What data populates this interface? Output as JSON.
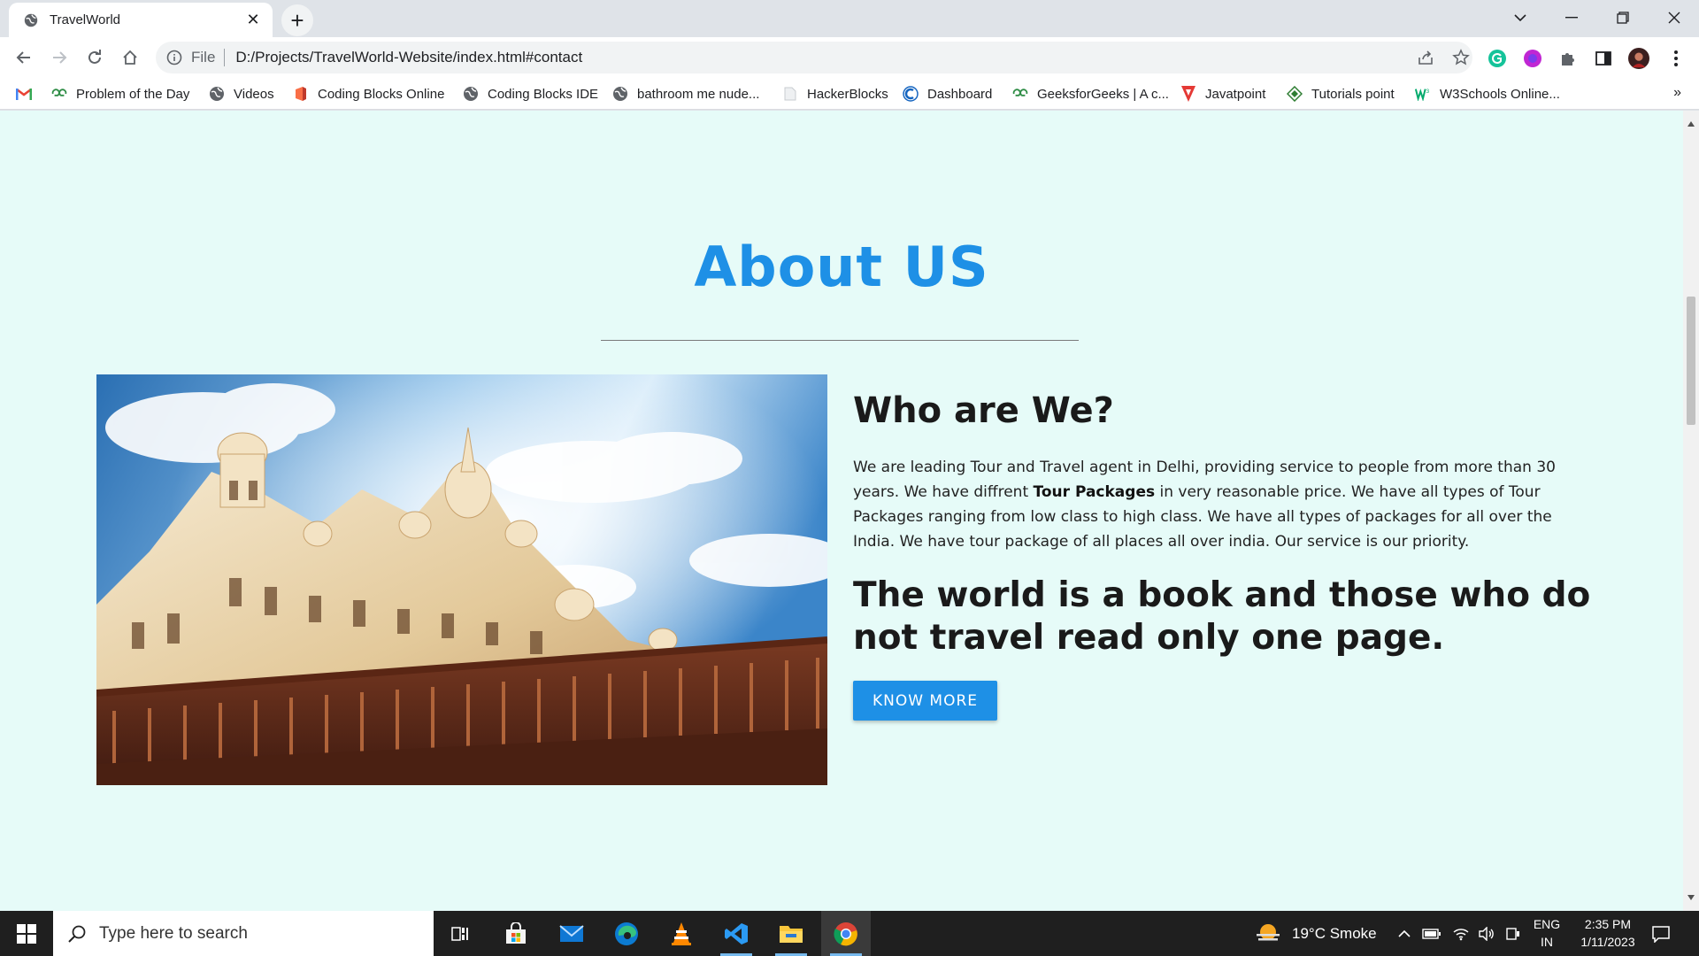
{
  "browser": {
    "tab_title": "TravelWorld",
    "new_tab_label": "+",
    "omnibox_scheme": "File",
    "url": "D:/Projects/TravelWorld-Website/index.html#contact"
  },
  "bookmarks": [
    {
      "label": "Problem of the Day",
      "icon": "gfg-icon"
    },
    {
      "label": "Videos",
      "icon": "globe-icon"
    },
    {
      "label": "Coding Blocks Online",
      "icon": "coding-blocks-icon"
    },
    {
      "label": "Coding Blocks IDE",
      "icon": "globe-icon"
    },
    {
      "label": "bathroom me nude...",
      "icon": "globe-icon"
    },
    {
      "label": "HackerBlocks",
      "icon": "page-icon"
    },
    {
      "label": "Dashboard",
      "icon": "dashboard-icon"
    },
    {
      "label": "GeeksforGeeks | A c...",
      "icon": "gfg-icon"
    },
    {
      "label": "Javatpoint",
      "icon": "javatpoint-icon"
    },
    {
      "label": "Tutorials point",
      "icon": "tutorialspoint-icon"
    },
    {
      "label": "W3Schools Online...",
      "icon": "w3schools-icon"
    }
  ],
  "page": {
    "section_title": "About US",
    "subtitle": "Who are We?",
    "desc_part1": "We are leading Tour and Travel agent in Delhi, providing service to people from more than 30 years. We have diffrent ",
    "desc_bold": "Tour Packages",
    "desc_part2": " in very reasonable price. We have all types of Tour Packages ranging from low class to high class. We have all types of packages for all over the India. We have tour package of all places all over india. Our service is our priority.",
    "quote": "The world is a book and those who do not travel read only one page.",
    "button_label": "KNOW MORE",
    "accent_color": "#1e90e6",
    "background_color": "#e6fbf8"
  },
  "taskbar": {
    "search_placeholder": "Type here to search",
    "weather": "19°C  Smoke",
    "lang_top": "ENG",
    "lang_bottom": "IN",
    "time": "2:35 PM",
    "date": "1/11/2023"
  }
}
